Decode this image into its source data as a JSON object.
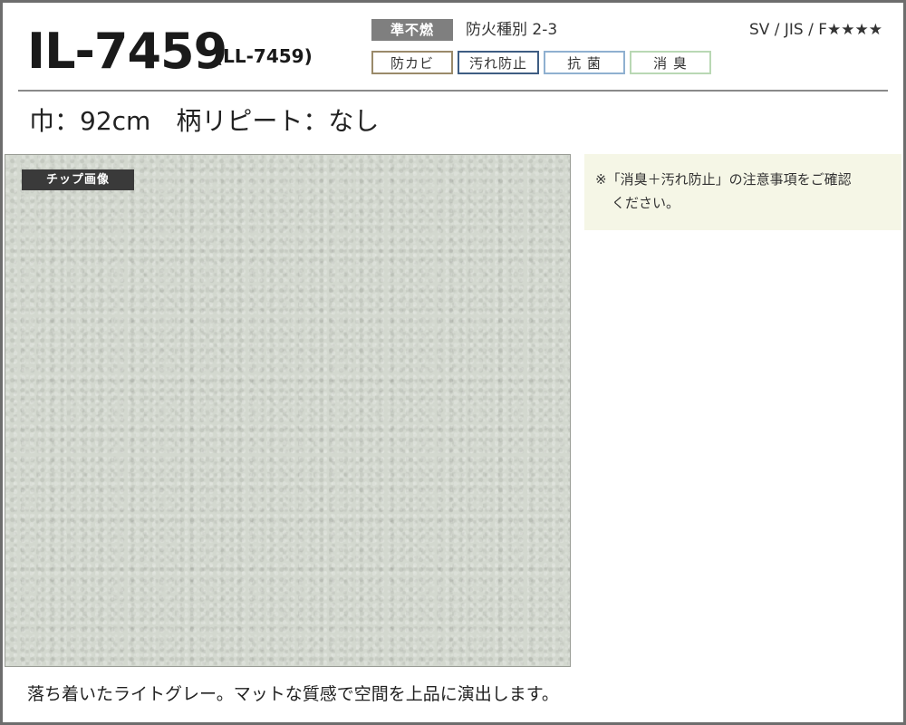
{
  "header": {
    "model": "IL-7459",
    "model_alt": "(LL-7459)",
    "fire_badge": "準不燃",
    "fire_class": "防火種別 2-3",
    "certification": "SV / JIS / F★★★★",
    "tags": [
      "防カビ",
      "汚れ防止",
      "抗 菌",
      "消 臭"
    ]
  },
  "spec": {
    "width_label": "巾：",
    "width_value": "92cm",
    "repeat_label": "柄リピート：",
    "repeat_value": "なし"
  },
  "chip": {
    "label": "チップ画像",
    "color": "#d3d8cf"
  },
  "note": {
    "line1": "※「消臭＋汚れ防止」の注意事項をご確認",
    "line2": "ください。"
  },
  "description": "落ち着いたライトグレー。マットな質感で空間を上品に演出します。"
}
